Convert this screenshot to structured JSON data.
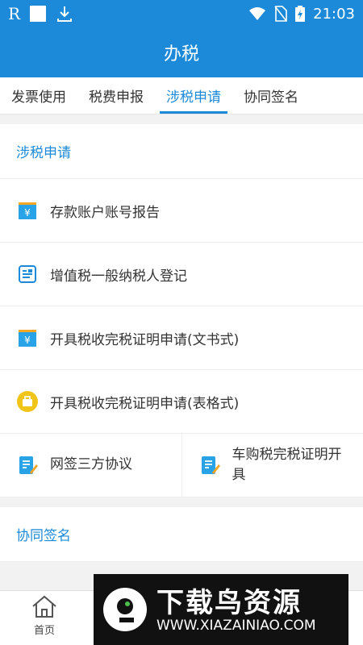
{
  "status_bar": {
    "left_letter": "R",
    "time": "21:03"
  },
  "app_title": "办税",
  "tabs": [
    {
      "label": "发票使用",
      "active": false
    },
    {
      "label": "税费申报",
      "active": false
    },
    {
      "label": "涉税申请",
      "active": true
    },
    {
      "label": "协同签名",
      "active": false
    }
  ],
  "sections": [
    {
      "title": "涉税申请",
      "items": [
        {
          "label": "存款账户账号报告",
          "icon": "yuan-folder-icon"
        },
        {
          "label": "增值税一般纳税人登记",
          "icon": "form-icon"
        },
        {
          "label": "开具税收完税证明申请(文书式)",
          "icon": "yuan-folder-icon"
        },
        {
          "label": "开具税收完税证明申请(表格式)",
          "icon": "briefcase-icon"
        }
      ],
      "split_items": [
        {
          "label": "网签三方协议",
          "icon": "document-edit-icon"
        },
        {
          "label": "车购税完税证明开具",
          "icon": "document-edit-icon"
        }
      ]
    },
    {
      "title": "协同签名"
    }
  ],
  "bottom_nav": {
    "home_label": "首页"
  },
  "watermark": {
    "title": "下载鸟资源",
    "url": "WWW.XIAZAINIAO.COM"
  },
  "colors": {
    "primary": "#1c8ad8",
    "icon_orange": "#f5a623",
    "icon_yellow": "#f0c419"
  }
}
